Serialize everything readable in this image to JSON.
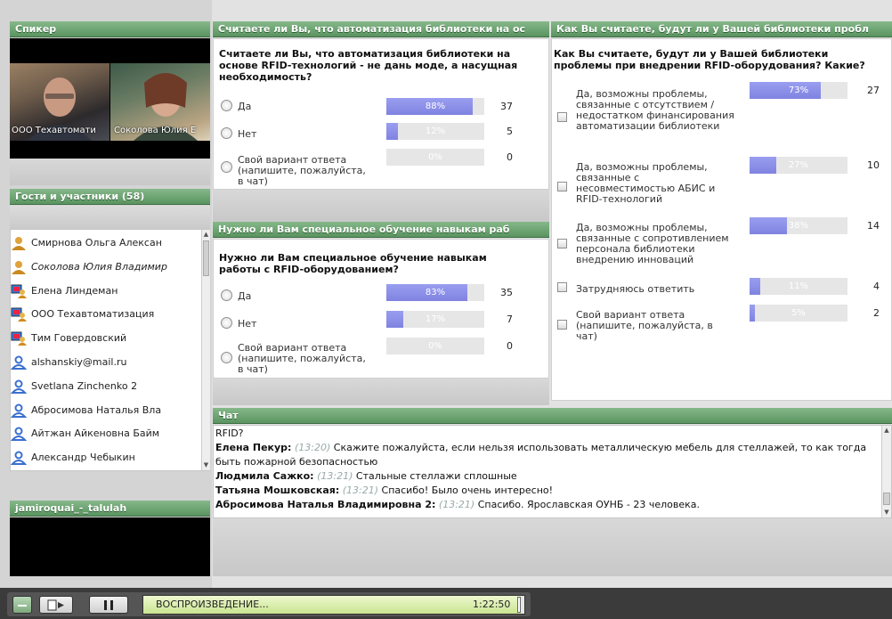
{
  "speaker": {
    "header": "Спикер",
    "cam1_label": "ООО Техавтомати",
    "cam2_label": "Соколова Юлия Е"
  },
  "guests": {
    "header": "Гости и участники (58)",
    "items": [
      {
        "name": "Смирнова Ольга Алексан",
        "icon": "presenter-icon",
        "italic": false
      },
      {
        "name": "Соколова Юлия Владимир",
        "icon": "presenter-icon",
        "italic": true
      },
      {
        "name": "Елена Линдеман",
        "icon": "webcam-user-icon",
        "italic": false
      },
      {
        "name": "ООО Техавтоматизация",
        "icon": "webcam-user-icon",
        "italic": false
      },
      {
        "name": "Тим Говердовский",
        "icon": "webcam-user-icon",
        "italic": false
      },
      {
        "name": "alshanskiy@mail.ru",
        "icon": "user-icon",
        "italic": false
      },
      {
        "name": "Svetlana Zinchenko 2",
        "icon": "user-icon",
        "italic": false
      },
      {
        "name": "Абросимова Наталья Вла",
        "icon": "user-icon",
        "italic": false
      },
      {
        "name": "Айтжан Айкеновна Байм",
        "icon": "user-icon",
        "italic": false
      },
      {
        "name": "Александр Чебыкин",
        "icon": "user-icon",
        "italic": false
      }
    ]
  },
  "video2": {
    "header": "jamiroquai_-_talulah"
  },
  "poll1": {
    "header": "Считаете ли Вы, что автоматизация библиотеки на ос",
    "question": "Считаете ли Вы, что автоматизация библиотеки на основе RFID-технологий - не дань моде, а насущная необходимость?",
    "options": [
      {
        "label": "Да",
        "percent": 88,
        "percent_label": "88%",
        "count": "37"
      },
      {
        "label": "Нет",
        "percent": 12,
        "percent_label": "12%",
        "count": "5"
      },
      {
        "label": "Свой вариант ответа (напишите, пожалуйста, в чат)",
        "percent": 0,
        "percent_label": "0%",
        "count": "0"
      }
    ]
  },
  "poll2": {
    "header": "Нужно ли Вам специальное обучение навыкам раб",
    "question": "Нужно ли Вам специальное обучение навыкам работы с RFID-оборудованием?",
    "options": [
      {
        "label": "Да",
        "percent": 83,
        "percent_label": "83%",
        "count": "35"
      },
      {
        "label": "Нет",
        "percent": 17,
        "percent_label": "17%",
        "count": "7"
      },
      {
        "label": "Свой вариант ответа (напишите, пожалуйста, в чат)",
        "percent": 0,
        "percent_label": "0%",
        "count": "0"
      }
    ]
  },
  "poll3": {
    "header": "Как Вы считаете, будут ли у Вашей библиотеки пробл",
    "question": "Как Вы считаете, будут ли у Вашей библиотеки проблемы при внедрении RFID-оборудования? Какие?",
    "options": [
      {
        "label": "Да, возможны проблемы, связанные с отсутствием / недостатком финансирования автоматизации библиотеки",
        "percent": 73,
        "percent_label": "73%",
        "count": "27"
      },
      {
        "label": "Да, возможны проблемы, связанные с несовместимостью АБИС и RFID-технологий",
        "percent": 27,
        "percent_label": "27%",
        "count": "10"
      },
      {
        "label": "Да, возможны проблемы, связанные с сопротивлением персонала библиотеки внедрению инноваций",
        "percent": 38,
        "percent_label": "38%",
        "count": "14"
      },
      {
        "label": "Затрудняюсь ответить",
        "percent": 11,
        "percent_label": "11%",
        "count": "4"
      },
      {
        "label": "Свой вариант ответа (напишите, пожалуйста, в чат)",
        "percent": 5,
        "percent_label": "5%",
        "count": "2"
      }
    ]
  },
  "chat": {
    "header": "Чат",
    "messages": [
      {
        "author": "",
        "time": "",
        "text": "RFID?"
      },
      {
        "author": "Елена Пекур:",
        "time": "(13:20)",
        "text": "Скажите пожалуйста, если нельзя использовать металлическую мебель для стеллажей, то как тогда быть пожарной безопасностью"
      },
      {
        "author": "Людмила Сажко:",
        "time": "(13:21)",
        "text": "Стальные стеллажи сплошные"
      },
      {
        "author": "Татьяна Мошковская:",
        "time": "(13:21)",
        "text": "Спасибо! Было очень интересно!"
      },
      {
        "author": "Абросимова Наталья Владимировна 2:",
        "time": "(13:21)",
        "text": "Спасибо. Ярославская ОУНБ - 23 человека."
      }
    ]
  },
  "player": {
    "status": "ВОСПРОИЗВЕДЕНИЕ...",
    "time": "1:22:50",
    "progress": 0.99
  }
}
